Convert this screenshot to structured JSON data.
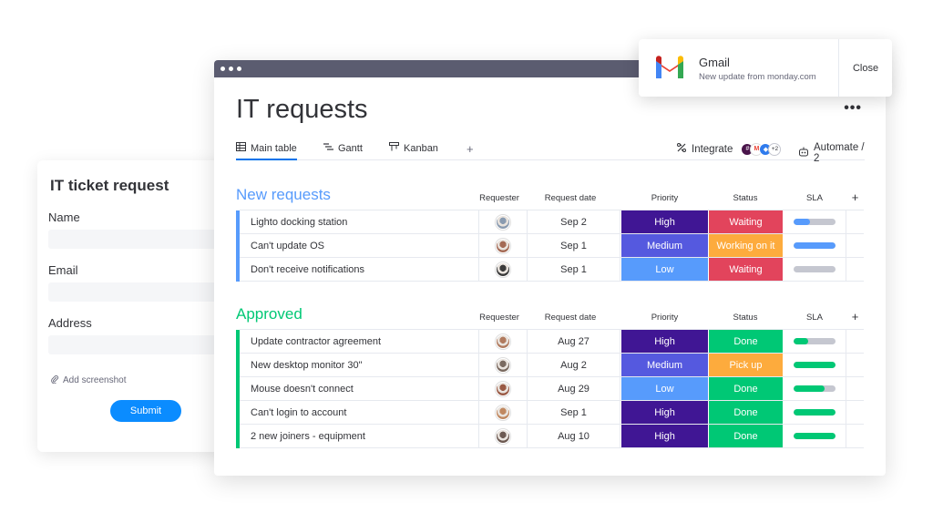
{
  "form": {
    "title": "IT ticket request",
    "fields": [
      {
        "label": "Name"
      },
      {
        "label": "Email"
      },
      {
        "label": "Address"
      }
    ],
    "attach_label": "Add screenshot",
    "submit_label": "Submit"
  },
  "board": {
    "title": "IT requests",
    "more": "•••",
    "tabs": [
      {
        "label": "Main table",
        "icon": "table-icon",
        "active": true
      },
      {
        "label": "Gantt",
        "icon": "gantt-icon"
      },
      {
        "label": "Kanban",
        "icon": "kanban-icon"
      }
    ],
    "add_tab": "+",
    "integrate_label": "Integrate",
    "integrate_extra": "+2",
    "automate_label": "Automate / 2"
  },
  "columns": {
    "requester": "Requester",
    "date": "Request date",
    "priority": "Priority",
    "status": "Status",
    "sla": "SLA",
    "add": "+"
  },
  "groups": [
    {
      "title": "New requests",
      "color": "#579bfc",
      "rows": [
        {
          "name": "Lighto docking station",
          "date": "Sep 2",
          "priority": "High",
          "status": "Waiting",
          "sla": 0.4,
          "sla_color": "#579bfc",
          "avatar": "#8a9bb0"
        },
        {
          "name": "Can't update OS",
          "date": "Sep 1",
          "priority": "Medium",
          "status": "Working on it",
          "sla": 1.0,
          "sla_color": "#579bfc",
          "avatar": "#a46a55"
        },
        {
          "name": "Don't receive notifications",
          "date": "Sep 1",
          "priority": "Low",
          "status": "Waiting",
          "sla": 0.0,
          "sla_color": "#579bfc",
          "avatar": "#3b3b3b"
        }
      ]
    },
    {
      "title": "Approved",
      "color": "#00c875",
      "rows": [
        {
          "name": "Update contractor agreement",
          "date": "Aug 27",
          "priority": "High",
          "status": "Done",
          "sla": 0.35,
          "sla_color": "#00c875",
          "avatar": "#b07a5e"
        },
        {
          "name": "New desktop monitor 30\"",
          "date": "Aug 2",
          "priority": "Medium",
          "status": "Pick up",
          "sla": 1.0,
          "sla_color": "#00c875",
          "avatar": "#7a6a60"
        },
        {
          "name": "Mouse doesn't connect",
          "date": "Aug 29",
          "priority": "Low",
          "status": "Done",
          "sla": 0.75,
          "sla_color": "#00c875",
          "avatar": "#9a5a45"
        },
        {
          "name": "Can't login to account",
          "date": "Sep 1",
          "priority": "High",
          "status": "Done",
          "sla": 1.0,
          "sla_color": "#00c875",
          "avatar": "#c08860"
        },
        {
          "name": "2 new joiners - equipment",
          "date": "Aug 10",
          "priority": "High",
          "status": "Done",
          "sla": 1.0,
          "sla_color": "#00c875",
          "avatar": "#6d5a52"
        }
      ]
    }
  ],
  "priority_colors": {
    "High": "#401694",
    "Medium": "#5559df",
    "Low": "#579bfc"
  },
  "status_colors": {
    "Waiting": "#e2445c",
    "Working on it": "#fdab3d",
    "Done": "#00c875",
    "Pick up": "#fdab3d"
  },
  "notification": {
    "title": "Gmail",
    "subtitle": "New update from monday.com",
    "close_label": "Close"
  }
}
